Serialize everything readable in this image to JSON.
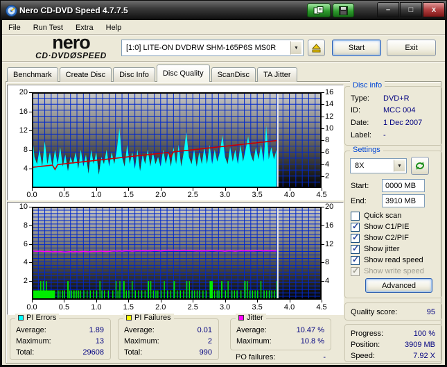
{
  "window": {
    "title": "Nero CD-DVD Speed 4.7.7.5",
    "minimize": "–",
    "maximize": "□",
    "close": "x"
  },
  "menu": {
    "items": [
      "File",
      "Run Test",
      "Extra",
      "Help"
    ]
  },
  "toolbar": {
    "logo_line1": "nero",
    "logo_line2": "CD·DVDØSPEED",
    "drive_selector": "[1:0]   LITE-ON DVDRW SHM-165P6S MS0R",
    "start_label": "Start",
    "exit_label": "Exit"
  },
  "tabs": [
    {
      "label": "Benchmark",
      "active": false
    },
    {
      "label": "Create Disc",
      "active": false
    },
    {
      "label": "Disc Info",
      "active": false
    },
    {
      "label": "Disc Quality",
      "active": true
    },
    {
      "label": "ScanDisc",
      "active": false
    },
    {
      "label": "TA Jitter",
      "active": false
    }
  ],
  "disc_info": {
    "title": "Disc info",
    "rows": [
      {
        "label": "Type:",
        "value": "DVD+R"
      },
      {
        "label": "ID:",
        "value": "MCC 004"
      },
      {
        "label": "Date:",
        "value": "1 Dec 2007"
      },
      {
        "label": "Label:",
        "value": "-"
      }
    ]
  },
  "settings": {
    "title": "Settings",
    "speed_selected": "8X",
    "start_label": "Start:",
    "start_value": "0000 MB",
    "end_label": "End:",
    "end_value": "3910 MB",
    "checkboxes": [
      {
        "label": "Quick scan",
        "checked": false,
        "disabled": false
      },
      {
        "label": "Show C1/PIE",
        "checked": true,
        "disabled": false
      },
      {
        "label": "Show C2/PIF",
        "checked": true,
        "disabled": false
      },
      {
        "label": "Show jitter",
        "checked": true,
        "disabled": false
      },
      {
        "label": "Show read speed",
        "checked": true,
        "disabled": false
      },
      {
        "label": "Show write speed",
        "checked": true,
        "disabled": true
      }
    ],
    "advanced_label": "Advanced"
  },
  "quality": {
    "label": "Quality score:",
    "value": "95"
  },
  "progress": {
    "rows": [
      {
        "label": "Progress:",
        "value": "100 %"
      },
      {
        "label": "Position:",
        "value": "3909 MB"
      },
      {
        "label": "Speed:",
        "value": "7.92 X"
      }
    ]
  },
  "stats": [
    {
      "title": "PI Errors",
      "swatch": "#00FFFF",
      "rows": [
        [
          "Average:",
          "1.89"
        ],
        [
          "Maximum:",
          "13"
        ],
        [
          "Total:",
          "29608"
        ]
      ]
    },
    {
      "title": "PI Failures",
      "swatch": "#FFFF00",
      "rows": [
        [
          "Average:",
          "0.01"
        ],
        [
          "Maximum:",
          "2"
        ],
        [
          "Total:",
          "990"
        ]
      ]
    },
    {
      "title": "Jitter",
      "swatch": "#FF00FF",
      "rows": [
        [
          "Average:",
          "10.47 %"
        ],
        [
          "Maximum:",
          "10.8 %"
        ]
      ],
      "extra": {
        "label": "PO failures:",
        "value": "-"
      }
    }
  ],
  "chart_data": [
    {
      "type": "area",
      "name": "pi-errors-chart",
      "title": "PI Errors and read speed vs disc position (GB)",
      "x_range": [
        0,
        4.5
      ],
      "x_ticks": [
        0.0,
        0.5,
        1.0,
        1.5,
        2.0,
        2.5,
        3.0,
        3.5,
        4.0,
        4.5
      ],
      "left_axis": {
        "range": [
          0,
          20
        ],
        "ticks": [
          20,
          16,
          12,
          8,
          4
        ]
      },
      "right_axis": {
        "range": [
          0,
          16
        ],
        "ticks": [
          16,
          14,
          12,
          10,
          8,
          6,
          4,
          2
        ]
      },
      "grid": true,
      "grid_rows": 16,
      "grid_cols": 45,
      "data_end_x": 3.82,
      "series": [
        {
          "name": "pi_errors",
          "color": "#00FFFF",
          "type": "area",
          "axis": "left",
          "x_step": 0.04,
          "values": [
            12,
            6.5,
            5,
            8,
            4.5,
            9.8,
            5,
            7.5,
            4.5,
            8,
            5,
            8.5,
            4.5,
            7,
            3.5,
            6.5,
            5,
            7.5,
            4,
            8,
            4.5,
            7,
            3,
            8,
            5,
            7.5,
            2.8,
            6.5,
            5,
            8,
            4.5,
            7.5,
            5,
            8,
            12.5,
            6.5,
            4.5,
            9,
            5,
            7.5,
            4,
            8,
            3.5,
            7,
            5,
            8,
            4.5,
            7.5,
            5,
            6.5,
            4.5,
            8,
            5,
            7.5,
            4.5,
            8.5,
            5,
            9,
            4.5,
            7.5,
            11.7,
            6.5,
            5,
            8,
            4.5,
            7.5,
            5,
            8.5,
            5,
            9,
            5,
            8,
            5.5,
            7.5,
            11,
            6.5,
            5,
            8.5,
            5.5,
            8,
            5,
            9,
            5.5,
            8,
            10.8,
            7,
            5.5,
            8.5,
            6,
            9,
            5.5,
            13,
            6,
            8.5,
            6,
            8
          ]
        },
        {
          "name": "read_speed",
          "color": "#CC0000",
          "type": "line",
          "axis": "right",
          "x_step": 0.04,
          "values": [
            3.45,
            3.5,
            3.54,
            3.59,
            3.64,
            3.69,
            3.73,
            3.78,
            3.83,
            3.1,
            3.92,
            3.97,
            4.01,
            4.06,
            4.11,
            4.16,
            4.2,
            4.25,
            4.3,
            4.34,
            4.39,
            4.44,
            4.49,
            4.53,
            4.58,
            4.63,
            4.67,
            4.72,
            4.77,
            4.81,
            4.86,
            4.91,
            4.96,
            5.0,
            5.05,
            5.1,
            5.14,
            5.19,
            5.24,
            5.29,
            5.33,
            5.38,
            5.43,
            5.47,
            5.52,
            5.57,
            5.61,
            5.66,
            5.71,
            5.76,
            5.8,
            5.85,
            5.9,
            5.94,
            5.2,
            6.04,
            6.09,
            6.13,
            6.18,
            6.23,
            6.27,
            6.32,
            6.37,
            6.41,
            6.46,
            6.51,
            6.56,
            6.6,
            6.65,
            6.7,
            6.74,
            6.79,
            6.84,
            6.89,
            6.93,
            6.98,
            7.03,
            7.07,
            7.12,
            7.17,
            7.21,
            7.26,
            7.31,
            7.36,
            7.4,
            7.45,
            7.5,
            7.54,
            7.59,
            7.64,
            7.68,
            7.73,
            7.78,
            7.83,
            7.87,
            7.92
          ]
        }
      ]
    },
    {
      "type": "bar",
      "name": "pi-failures-chart",
      "title": "PI Failures and jitter vs disc position (GB)",
      "x_range": [
        0,
        4.5
      ],
      "x_ticks": [
        0.0,
        0.5,
        1.0,
        1.5,
        2.0,
        2.5,
        3.0,
        3.5,
        4.0,
        4.5
      ],
      "left_axis": {
        "range": [
          0,
          10
        ],
        "ticks": [
          10,
          8,
          6,
          4,
          2
        ]
      },
      "right_axis": {
        "range": [
          0,
          20
        ],
        "ticks": [
          20,
          16,
          12,
          8,
          4
        ]
      },
      "grid": true,
      "grid_rows": 27,
      "grid_cols": 45,
      "data_end_x": 3.82,
      "series": [
        {
          "name": "pi_failures",
          "color": "#00EE00",
          "type": "bars",
          "axis": "left",
          "bars": [
            [
              0,
              0.36,
              1
            ],
            [
              0.13,
              0.015,
              2
            ],
            [
              0.17,
              0.015,
              2
            ],
            [
              0.22,
              0.015,
              2
            ],
            [
              0.4,
              0.015,
              1
            ],
            [
              0.43,
              0.015,
              1
            ],
            [
              0.47,
              0.015,
              1
            ],
            [
              0.5,
              0.015,
              1
            ],
            [
              0.55,
              0.02,
              2
            ],
            [
              0.58,
              0.015,
              1
            ],
            [
              0.61,
              0.015,
              1
            ],
            [
              0.64,
              0.015,
              1
            ],
            [
              0.66,
              0.015,
              1
            ],
            [
              0.69,
              0.015,
              1
            ],
            [
              0.72,
              0.015,
              1
            ],
            [
              0.75,
              0.015,
              1
            ],
            [
              0.8,
              0.015,
              1
            ],
            [
              0.85,
              0.015,
              1
            ],
            [
              0.9,
              0.015,
              1
            ],
            [
              0.95,
              0.015,
              1
            ],
            [
              1.0,
              0.015,
              1
            ],
            [
              1.05,
              0.015,
              2
            ],
            [
              1.08,
              0.015,
              1
            ],
            [
              1.12,
              0.015,
              1
            ],
            [
              1.18,
              0.015,
              1
            ],
            [
              1.25,
              0.015,
              1
            ],
            [
              1.3,
              0.015,
              2
            ],
            [
              1.33,
              0.015,
              1
            ],
            [
              1.36,
              0.015,
              2
            ],
            [
              1.42,
              0.02,
              2
            ],
            [
              1.46,
              0.015,
              1
            ],
            [
              1.5,
              0.015,
              1
            ],
            [
              1.55,
              0.015,
              2
            ],
            [
              1.6,
              0.015,
              1
            ],
            [
              1.65,
              0.015,
              1
            ],
            [
              1.7,
              0.015,
              1
            ],
            [
              1.75,
              0.015,
              1
            ],
            [
              1.8,
              0.02,
              2
            ],
            [
              1.84,
              0.015,
              2
            ],
            [
              1.88,
              0.015,
              1
            ],
            [
              1.92,
              0.015,
              1
            ],
            [
              1.95,
              0.015,
              1
            ],
            [
              2.0,
              0.015,
              1
            ],
            [
              2.05,
              0.015,
              2
            ],
            [
              2.1,
              0.015,
              1
            ],
            [
              2.15,
              0.015,
              1
            ],
            [
              2.2,
              0.02,
              2
            ],
            [
              2.25,
              0.015,
              1
            ],
            [
              2.3,
              0.015,
              1
            ],
            [
              2.35,
              0.015,
              1
            ],
            [
              2.4,
              0.015,
              2
            ],
            [
              2.44,
              0.015,
              2
            ],
            [
              2.48,
              0.015,
              1
            ],
            [
              2.52,
              0.015,
              1
            ],
            [
              2.56,
              0.015,
              1
            ],
            [
              2.6,
              0.015,
              1
            ],
            [
              2.65,
              0.015,
              1
            ],
            [
              2.7,
              0.015,
              1
            ],
            [
              2.76,
              0.05,
              2
            ],
            [
              2.83,
              0.015,
              1
            ],
            [
              2.87,
              0.015,
              1
            ],
            [
              2.9,
              0.015,
              1
            ],
            [
              2.94,
              0.02,
              2
            ],
            [
              3.0,
              0.015,
              1
            ],
            [
              3.04,
              0.015,
              2
            ],
            [
              3.1,
              0.015,
              1
            ],
            [
              3.14,
              0.015,
              1
            ],
            [
              3.18,
              0.015,
              1
            ],
            [
              3.24,
              0.015,
              1
            ],
            [
              3.3,
              0.02,
              2
            ],
            [
              3.34,
              0.015,
              2
            ],
            [
              3.38,
              0.015,
              1
            ],
            [
              3.42,
              0.015,
              1
            ],
            [
              3.46,
              0.015,
              1
            ],
            [
              3.5,
              0.015,
              1
            ],
            [
              3.55,
              0.015,
              2
            ],
            [
              3.6,
              0.015,
              1
            ],
            [
              3.64,
              0.015,
              1
            ],
            [
              3.68,
              0.015,
              1
            ],
            [
              3.72,
              0.015,
              1
            ],
            [
              3.76,
              0.015,
              1
            ],
            [
              3.8,
              0.015,
              2
            ]
          ]
        },
        {
          "name": "jitter",
          "color": "#FF00FF",
          "type": "line",
          "axis": "right",
          "x_step": 0.04,
          "values": [
            10.5,
            10.45,
            10.4,
            10.45,
            10.4,
            10.35,
            10.4,
            10.35,
            10.3,
            10.35,
            10.3,
            10.35,
            10.3,
            10.25,
            10.3,
            10.35,
            10.3,
            10.35,
            10.3,
            10.35,
            10.4,
            10.35,
            10.3,
            10.35,
            10.4,
            10.35,
            10.4,
            10.45,
            10.4,
            10.35,
            10.4,
            10.45,
            10.5,
            10.45,
            10.5,
            10.45,
            10.5,
            10.55,
            10.5,
            10.45,
            10.5,
            10.55,
            10.5,
            10.55,
            10.5,
            10.55,
            10.5,
            10.55,
            10.6,
            10.55,
            10.5,
            10.55,
            10.6,
            10.65,
            10.6,
            10.65,
            10.6,
            10.55,
            10.6,
            10.65,
            10.6,
            10.55,
            10.6,
            10.55,
            10.5,
            10.55,
            10.5,
            10.55,
            10.5,
            10.55,
            10.6,
            10.55,
            10.5,
            10.55,
            10.5,
            10.45,
            10.5,
            10.55,
            10.5,
            10.45,
            10.5,
            10.55,
            10.5,
            10.55,
            10.5,
            10.55,
            10.5,
            10.55,
            10.6,
            10.55,
            10.5,
            10.55,
            10.5,
            10.55,
            10.5,
            10.5
          ]
        }
      ]
    }
  ],
  "colors": {
    "plot_grid": "#0028CC",
    "plot_top": "#C9C9C9",
    "plot_bottom": "#000000",
    "end_line": "#ECECEC",
    "value_text": "#000080"
  }
}
